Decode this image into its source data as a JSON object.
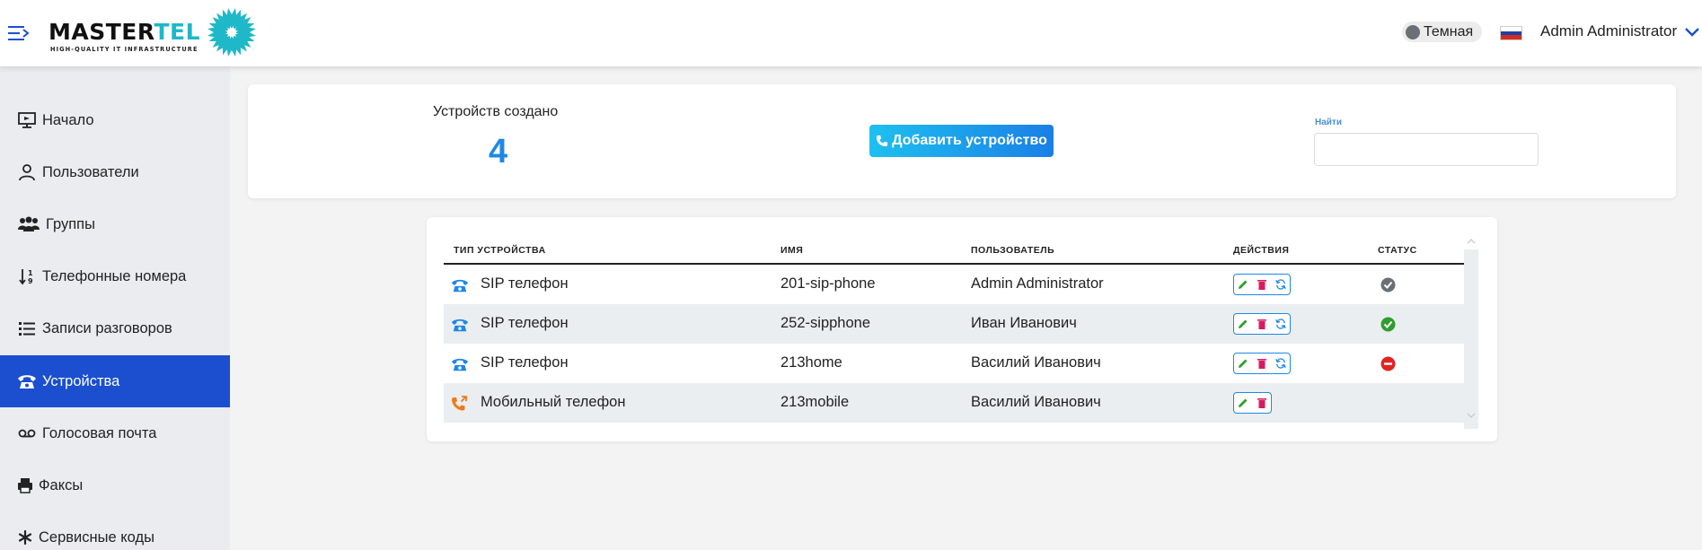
{
  "header": {
    "logo_main": "MASTER",
    "logo_accent": "TEL",
    "logo_tagline": "HIGH-QUALITY IT INFRASTRUCTURE",
    "theme_label": "Темная",
    "user_name": "Admin Administrator"
  },
  "sidebar": {
    "items": [
      {
        "label": "Начало",
        "icon": "monitor-icon"
      },
      {
        "label": "Пользователи",
        "icon": "user-icon"
      },
      {
        "label": "Группы",
        "icon": "users-icon"
      },
      {
        "label": "Телефонные номера",
        "icon": "sort-numeric-icon"
      },
      {
        "label": "Записи разговоров",
        "icon": "list-icon"
      },
      {
        "label": "Устройства",
        "icon": "telephone-icon",
        "active": true
      },
      {
        "label": "Голосовая почта",
        "icon": "voicemail-icon"
      },
      {
        "label": "Факсы",
        "icon": "printer-icon"
      },
      {
        "label": "Сервисные коды",
        "icon": "asterisk-icon"
      }
    ]
  },
  "summary": {
    "label": "Устройств создано",
    "value": "4",
    "add_button": "Добавить устройство",
    "search_label": "Найти",
    "search_value": ""
  },
  "table": {
    "columns": [
      "ТИП УСТРОЙСТВА",
      "ИМЯ",
      "ПОЛЬЗОВАТЕЛЬ",
      "ДЕЙСТВИЯ",
      "СТАТУС"
    ],
    "rows": [
      {
        "type": "SIP телефон",
        "icon": "desk-phone-icon",
        "name": "201-sip-phone",
        "user": "Admin Administrator",
        "actions": [
          "edit",
          "delete",
          "sync"
        ],
        "status": "offline"
      },
      {
        "type": "SIP телефон",
        "icon": "desk-phone-icon",
        "name": "252-sipphone",
        "user": "Иван Иванович",
        "actions": [
          "edit",
          "delete",
          "sync"
        ],
        "status": "online"
      },
      {
        "type": "SIP телефон",
        "icon": "desk-phone-icon",
        "name": "213home",
        "user": "Василий Иванович",
        "actions": [
          "edit",
          "delete",
          "sync"
        ],
        "status": "error"
      },
      {
        "type": "Мобильный телефон",
        "icon": "mobile-forward-icon",
        "name": "213mobile",
        "user": "Василий Иванович",
        "actions": [
          "edit",
          "delete"
        ],
        "status": "none"
      }
    ]
  },
  "colors": {
    "accent": "#1b4fd0",
    "number": "#1e88e5",
    "status_offline": "#6b6f76",
    "status_online": "#2e9e2e",
    "status_error": "#e02424"
  }
}
